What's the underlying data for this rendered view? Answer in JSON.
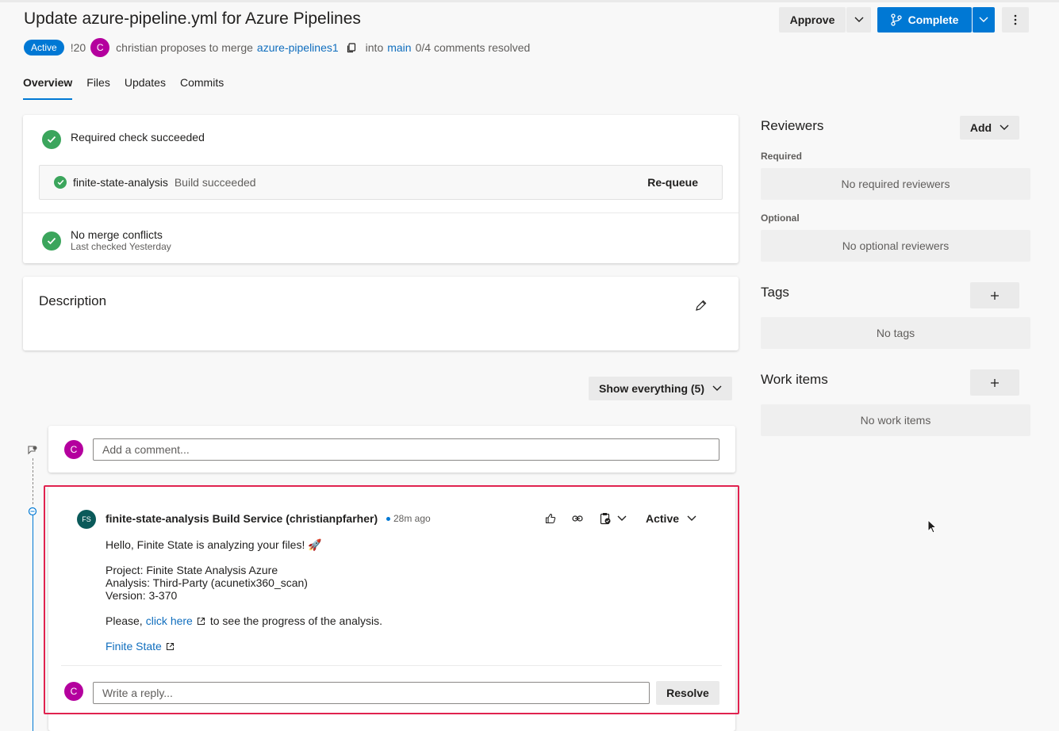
{
  "page": {
    "title": "Update azure-pipeline.yml for Azure Pipelines"
  },
  "header": {
    "approve_label": "Approve",
    "complete_label": "Complete",
    "status_badge": "Active",
    "pr_id": "!20",
    "author_initial": "C",
    "proposal_text": "christian proposes to merge",
    "source_branch": "azure-pipelines1",
    "into_text": "into",
    "target_branch": "main",
    "comments_resolved": "0/4 comments resolved"
  },
  "tabs": [
    {
      "label": "Overview",
      "active": true
    },
    {
      "label": "Files",
      "active": false
    },
    {
      "label": "Updates",
      "active": false
    },
    {
      "label": "Commits",
      "active": false
    }
  ],
  "checks": {
    "required_check": "Required check succeeded",
    "build_name": "finite-state-analysis",
    "build_status": "Build succeeded",
    "requeue_label": "Re-queue",
    "merge_title": "No merge conflicts",
    "merge_subtitle": "Last checked Yesterday"
  },
  "description": {
    "title": "Description"
  },
  "activity": {
    "filter_label": "Show everything (5)",
    "comment_placeholder": "Add a comment...",
    "user_initial": "C"
  },
  "thread": {
    "author_initials": "FS",
    "author": "finite-state-analysis Build Service (christianpfarher)",
    "time": "28m ago",
    "status": "Active",
    "line1": "Hello, Finite State is analyzing your files! 🚀",
    "project": "Project: Finite State Analysis Azure",
    "analysis": "Analysis: Third-Party (acunetix360_scan)",
    "version": "Version: 3-370",
    "please_prefix": "Please,",
    "click_here": "click here",
    "please_suffix": "to see the progress of the analysis.",
    "finite_state_link": "Finite State",
    "reply_placeholder": "Write a reply...",
    "resolve_label": "Resolve"
  },
  "sidebar": {
    "reviewers_title": "Reviewers",
    "add_label": "Add",
    "required_label": "Required",
    "no_required": "No required reviewers",
    "optional_label": "Optional",
    "no_optional": "No optional reviewers",
    "tags_title": "Tags",
    "no_tags": "No tags",
    "work_items_title": "Work items",
    "no_work_items": "No work items"
  },
  "colors": {
    "accent": "#0078d4",
    "success": "#3ba55c",
    "avatar": "#b4009e",
    "highlight_border": "#e0224f"
  }
}
